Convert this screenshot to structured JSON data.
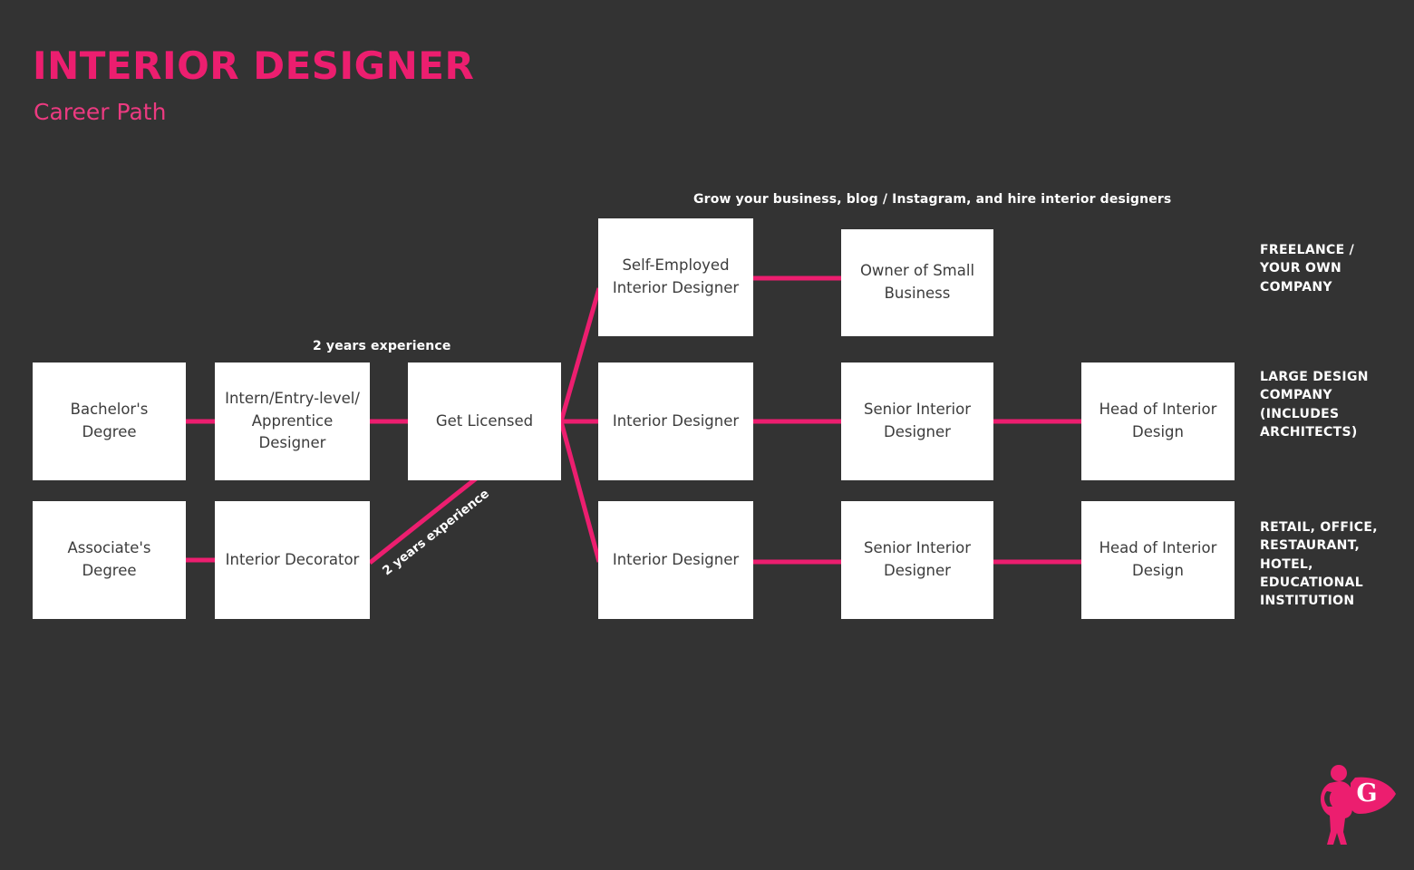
{
  "header": {
    "title": "INTERIOR DESIGNER",
    "subtitle": "Career Path",
    "accent_color": "#EC1E6F",
    "background_color": "#333333"
  },
  "annotations": {
    "top_note": "Grow your business, blog / Instagram, and hire interior designers",
    "experience_upper": "2 years experience",
    "experience_diagonal": "2 years experience"
  },
  "nodes": {
    "bachelors_degree": "Bachelor's Degree",
    "intern_entry": "Intern/Entry-level/\nApprentice Designer",
    "get_licensed": "Get Licensed",
    "associates_degree": "Associate's Degree",
    "interior_decorator": "Interior Decorator",
    "self_employed": "Self-Employed\nInterior Designer",
    "owner_small_business": "Owner of Small\nBusiness",
    "interior_designer_mid": "Interior Designer",
    "senior_interior_designer_mid": "Senior Interior\nDesigner",
    "head_of_interior_design_mid": "Head of Interior\nDesign",
    "interior_designer_low": "Interior Designer",
    "senior_interior_designer_low": "Senior Interior\nDesigner",
    "head_of_interior_design_low": "Head of Interior\nDesign"
  },
  "node_lines": {
    "intern_entry": [
      "Intern/Entry-level/",
      "Apprentice",
      "Designer"
    ],
    "self_employed": [
      "Self-Employed",
      "Interior Designer"
    ],
    "owner_small_business": [
      "Owner of Small",
      "Business"
    ],
    "senior_interior_designer_mid": [
      "Senior Interior",
      "Designer"
    ],
    "head_of_interior_design_mid": [
      "Head of Interior",
      "Design"
    ],
    "senior_interior_designer_low": [
      "Senior Interior",
      "Designer"
    ],
    "head_of_interior_design_low": [
      "Head of Interior",
      "Design"
    ]
  },
  "categories": {
    "freelance": [
      "FREELANCE /",
      "YOUR OWN",
      "COMPANY"
    ],
    "large_design": [
      "LARGE DESIGN",
      "COMPANY",
      "(INCLUDES",
      "ARCHITECTS)"
    ],
    "retail_office": [
      "RETAIL, OFFICE,",
      "RESTAURANT,",
      "HOTEL,",
      "EDUCATIONAL",
      "INSTITUTION"
    ]
  },
  "logo": {
    "name": "superhero-logo",
    "letter": "G",
    "color": "#EC1E6F"
  }
}
